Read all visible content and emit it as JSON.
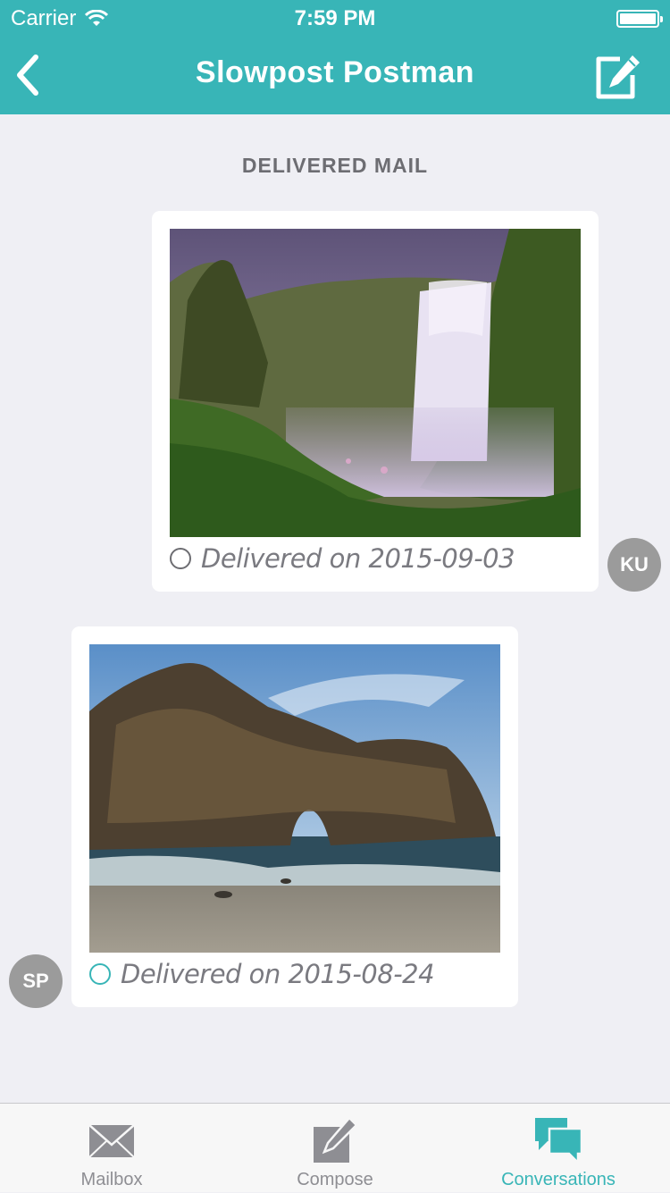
{
  "status_bar": {
    "carrier": "Carrier",
    "time": "7:59 PM"
  },
  "nav": {
    "title": "Slowpost Postman",
    "back_icon": "chevron-left-icon",
    "compose_icon": "compose-icon"
  },
  "section": {
    "title": "DELIVERED MAIL"
  },
  "mail": [
    {
      "photo": "waterfall-photo",
      "status": "Delivered on 2015-09-03",
      "avatar": "KU",
      "indicator_color": "#6d6d72"
    },
    {
      "photo": "sea-arch-photo",
      "status": "Delivered on 2015-08-24",
      "avatar": "SP",
      "indicator_color": "#38b5b7"
    }
  ],
  "tabs": [
    {
      "label": "Mailbox",
      "icon": "envelope-icon",
      "active": false
    },
    {
      "label": "Compose",
      "icon": "compose-icon",
      "active": false
    },
    {
      "label": "Conversations",
      "icon": "chat-bubbles-icon",
      "active": true
    }
  ],
  "colors": {
    "accent": "#38b5b7",
    "background": "#efeff4",
    "avatar": "#9b9b9b"
  }
}
